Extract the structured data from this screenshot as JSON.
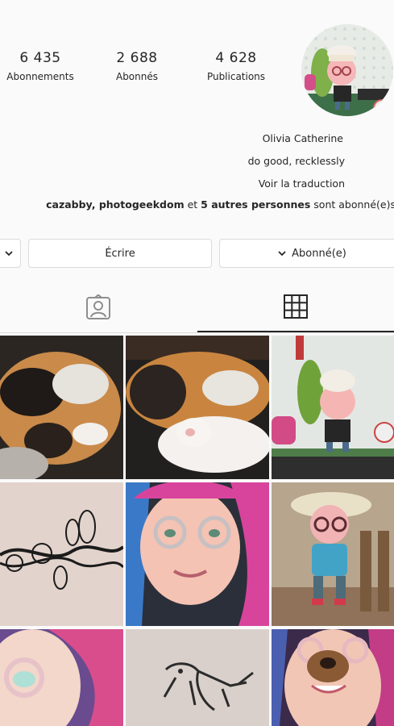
{
  "profile": {
    "name": "Olivia Catherine",
    "tagline": "do good, recklessly",
    "translate_link": "Voir la traduction",
    "followed_by_prefix": "cazabby, photogeekdom",
    "followed_by_mid": "et",
    "followed_by_others": "5 autres personnes",
    "followed_by_suffix": "sont abonné(e)s"
  },
  "stats": [
    {
      "value": "4 628",
      "label": "Publications"
    },
    {
      "value": "2 688",
      "label": "Abonnés"
    },
    {
      "value": "6 435",
      "label": "Abonnements"
    }
  ],
  "actions": {
    "following_label": "Abonné(e)",
    "message_label": "Écrire"
  },
  "tabs": {
    "grid_icon": "grid-icon",
    "tagged_icon": "tagged-person-icon"
  },
  "grid": {
    "posts": [
      "calico-cat-sleeping",
      "calico-cat-paws",
      "animal-crossing-avatar-room",
      "floral-tattoo",
      "selfie-pink-blue-hair",
      "animal-crossing-avatar-hat",
      "selfie-glasses",
      "gecko-tattoo",
      "selfie-dog-filter"
    ]
  },
  "colors": {
    "border": "#dbdbdb",
    "text": "#262626",
    "background": "#fafafa"
  }
}
